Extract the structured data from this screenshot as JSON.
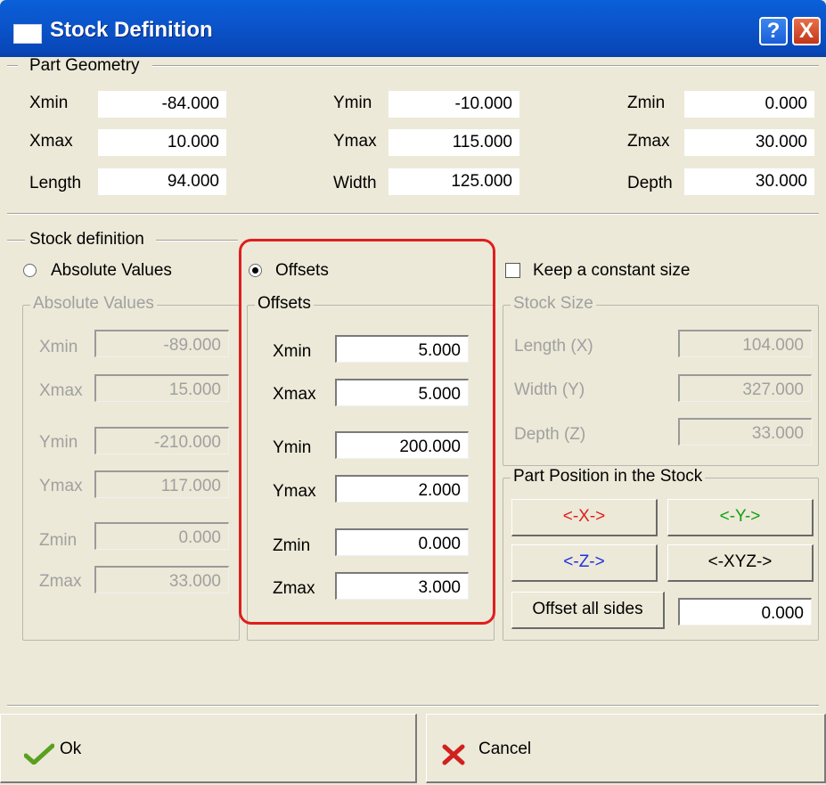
{
  "window": {
    "title": "Stock Definition",
    "help_label": "?",
    "close_label": "X"
  },
  "part_geometry": {
    "caption": "Part Geometry",
    "rows": [
      {
        "label": "Xmin",
        "value": "-84.000"
      },
      {
        "label": "Xmax",
        "value": "10.000"
      },
      {
        "label": "Length",
        "value": "94.000"
      },
      {
        "label": "Ymin",
        "value": "-10.000"
      },
      {
        "label": "Ymax",
        "value": "115.000"
      },
      {
        "label": "Width",
        "value": "125.000"
      },
      {
        "label": "Zmin",
        "value": "0.000"
      },
      {
        "label": "Zmax",
        "value": "30.000"
      },
      {
        "label": "Depth",
        "value": "30.000"
      }
    ]
  },
  "stock_definition": {
    "caption": "Stock definition",
    "radio_absolute": {
      "label": "Absolute Values",
      "selected": false
    },
    "radio_offsets": {
      "label": "Offsets",
      "selected": true
    },
    "keep_constant": {
      "label": "Keep a constant size",
      "checked": false
    }
  },
  "absolute_values": {
    "caption": "Absolute Values",
    "rows": [
      {
        "label": "Xmin",
        "value": "-89.000"
      },
      {
        "label": "Xmax",
        "value": "15.000"
      },
      {
        "label": "Ymin",
        "value": "-210.000"
      },
      {
        "label": "Ymax",
        "value": "117.000"
      },
      {
        "label": "Zmin",
        "value": "0.000"
      },
      {
        "label": "Zmax",
        "value": "33.000"
      }
    ]
  },
  "offsets": {
    "caption": "Offsets",
    "rows": [
      {
        "label": "Xmin",
        "value": "5.000"
      },
      {
        "label": "Xmax",
        "value": "5.000"
      },
      {
        "label": "Ymin",
        "value": "200.000"
      },
      {
        "label": "Ymax",
        "value": "2.000"
      },
      {
        "label": "Zmin",
        "value": "0.000"
      },
      {
        "label": "Zmax",
        "value": "3.000"
      }
    ]
  },
  "stock_size": {
    "caption": "Stock Size",
    "rows": [
      {
        "label": "Length (X)",
        "value": "104.000"
      },
      {
        "label": "Width  (Y)",
        "value": "327.000"
      },
      {
        "label": "Depth  (Z)",
        "value": "33.000"
      }
    ]
  },
  "part_position": {
    "caption": "Part Position in the Stock",
    "btn_x": "<-X->",
    "btn_y": "<-Y->",
    "btn_z": "<-Z->",
    "btn_xyz": "<-XYZ->",
    "offset_all_label": "Offset all sides",
    "offset_all_value": "0.000"
  },
  "footer": {
    "ok_label": "Ok",
    "cancel_label": "Cancel"
  },
  "colors": {
    "x_button": "#e02020",
    "y_button": "#10a010",
    "z_button": "#2030e0",
    "highlight": "#e01e1e"
  }
}
